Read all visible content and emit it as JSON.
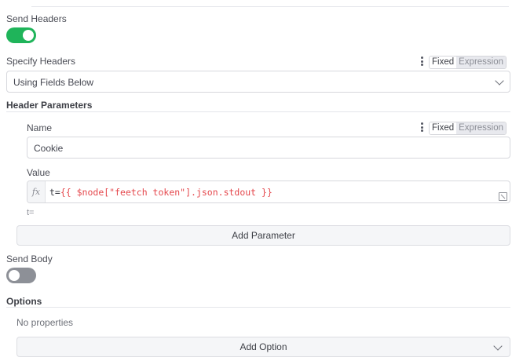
{
  "send_headers": {
    "label": "Send Headers",
    "enabled": true
  },
  "specify_headers": {
    "label": "Specify Headers",
    "mode_fixed": "Fixed",
    "mode_expression": "Expression",
    "value": "Using Fields Below"
  },
  "header_parameters": {
    "title": "Header Parameters",
    "name_label": "Name",
    "name_value": "Cookie",
    "mode_fixed": "Fixed",
    "mode_expression": "Expression",
    "value_label": "Value",
    "value_prefix": "t=",
    "value_expression": "{{ $node[\"feetch token\"].json.stdout }}",
    "value_preview": "t=",
    "fx_label": "fx"
  },
  "add_parameter_label": "Add Parameter",
  "send_body": {
    "label": "Send Body",
    "enabled": false
  },
  "options": {
    "title": "Options",
    "empty_text": "No properties",
    "add_option_label": "Add Option"
  }
}
